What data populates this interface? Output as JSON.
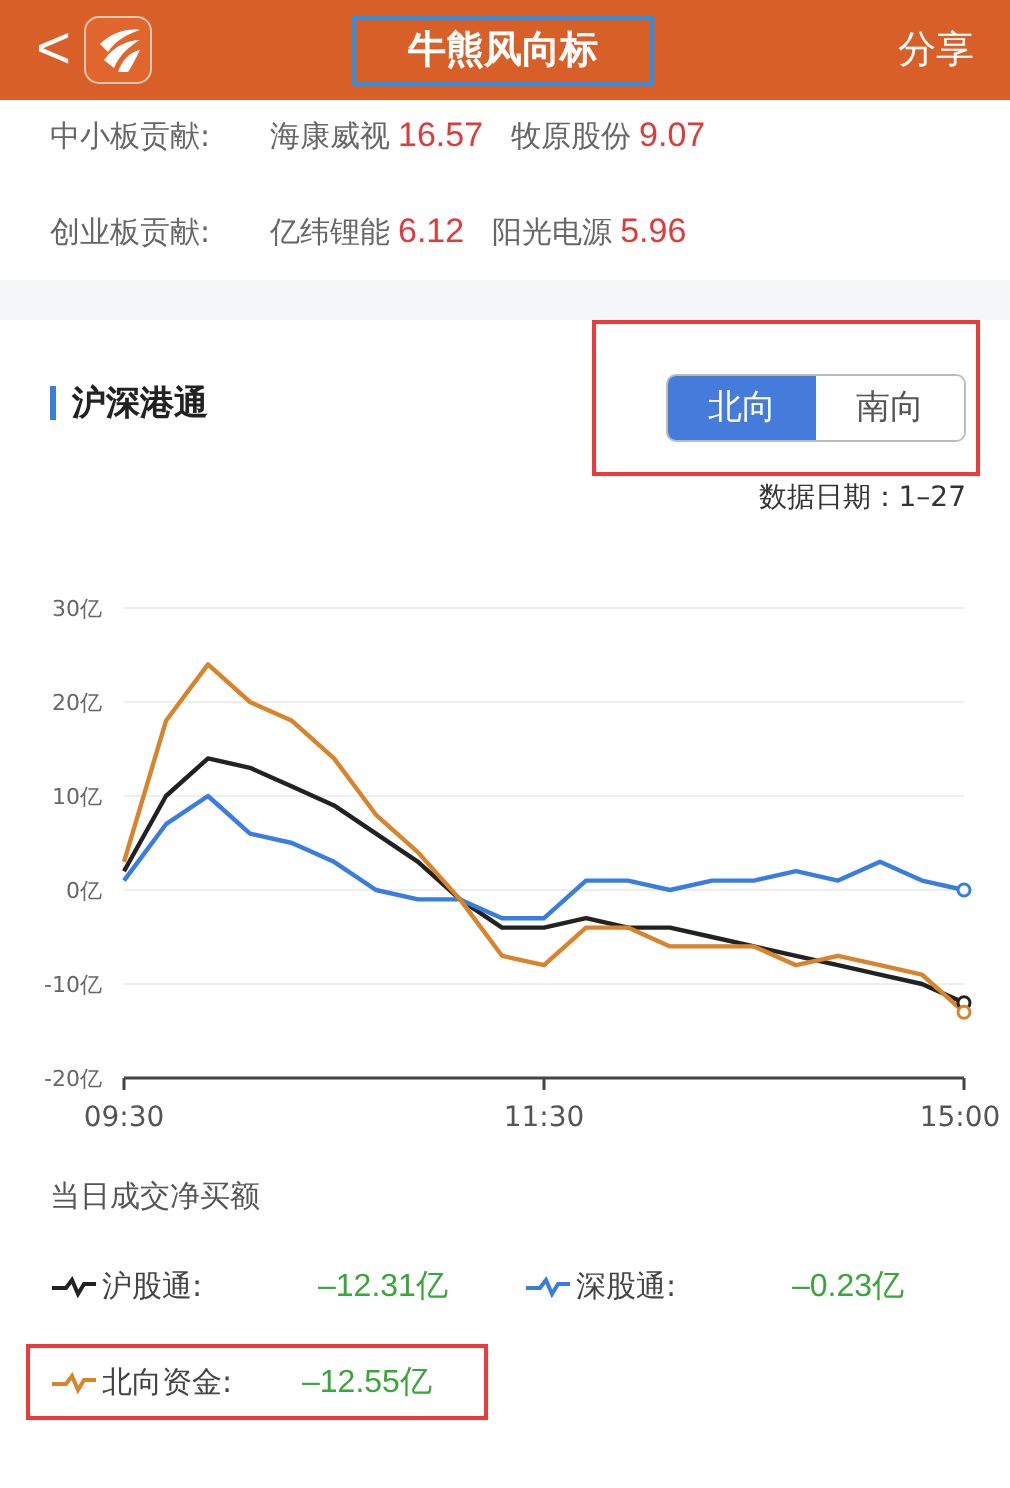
{
  "header": {
    "back": "<",
    "title": "牛熊风向标",
    "title_highlighted": true,
    "share": "分享"
  },
  "contributions": [
    {
      "label": "中小板贡献:",
      "stocks": [
        {
          "name": "海康威视",
          "value": "16.57"
        },
        {
          "name": "牧原股份",
          "value": "9.07"
        }
      ]
    },
    {
      "label": "创业板贡献:",
      "stocks": [
        {
          "name": "亿纬锂能",
          "value": "6.12"
        },
        {
          "name": "阳光电源",
          "value": "5.96"
        }
      ]
    }
  ],
  "section": {
    "title": "沪深港通",
    "toggle_highlighted": true,
    "toggle": [
      {
        "label": "北向",
        "selected": true
      },
      {
        "label": "南向",
        "selected": false
      }
    ],
    "date": "数据日期：1–27",
    "chart_data": {
      "type": "line",
      "categories": [
        "09:30",
        null,
        null,
        null,
        null,
        null,
        null,
        null,
        null,
        null,
        "11:30",
        null,
        null,
        null,
        null,
        null,
        null,
        null,
        null,
        null,
        "15:00"
      ],
      "yticks": [
        {
          "value": 30,
          "label": "30亿"
        },
        {
          "value": 20,
          "label": "20亿"
        },
        {
          "value": 10,
          "label": "10亿"
        },
        {
          "value": 0,
          "label": "0亿"
        },
        {
          "value": -10,
          "label": "-10亿"
        },
        {
          "value": -20,
          "label": "-20亿"
        }
      ],
      "ylim": [
        -20,
        30
      ],
      "grid": true,
      "series": [
        {
          "color": "#222222",
          "values": [
            2,
            10,
            14,
            13,
            11,
            9,
            6,
            3,
            -1,
            -4,
            -4,
            -3,
            -4,
            -4,
            -5,
            -6,
            -7,
            -8,
            -9,
            -10,
            -12
          ]
        },
        {
          "color": "#3a7de0",
          "values": [
            1,
            7,
            10,
            6,
            5,
            3,
            0,
            -1,
            -1,
            -3,
            -3,
            1,
            1,
            0,
            1,
            1,
            2,
            1,
            3,
            1,
            0
          ]
        },
        {
          "color": "#d9832a",
          "values": [
            3,
            18,
            24,
            20,
            18,
            14,
            8,
            4,
            -1,
            -7,
            -8,
            -4,
            -4,
            -6,
            -6,
            -6,
            -8,
            -7,
            -8,
            -9,
            -13
          ]
        }
      ]
    }
  },
  "summary": {
    "title": "当日成交净买额",
    "items": [
      {
        "label": "沪股通:",
        "value": "–12.31亿",
        "color": "#222222",
        "highlighted": false
      },
      {
        "label": "深股通:",
        "value": "–0.23亿",
        "color": "#3a7de0",
        "highlighted": false
      },
      {
        "label": "北向资金:",
        "value": "–12.55亿",
        "color": "#d9832a",
        "highlighted": true
      }
    ]
  }
}
